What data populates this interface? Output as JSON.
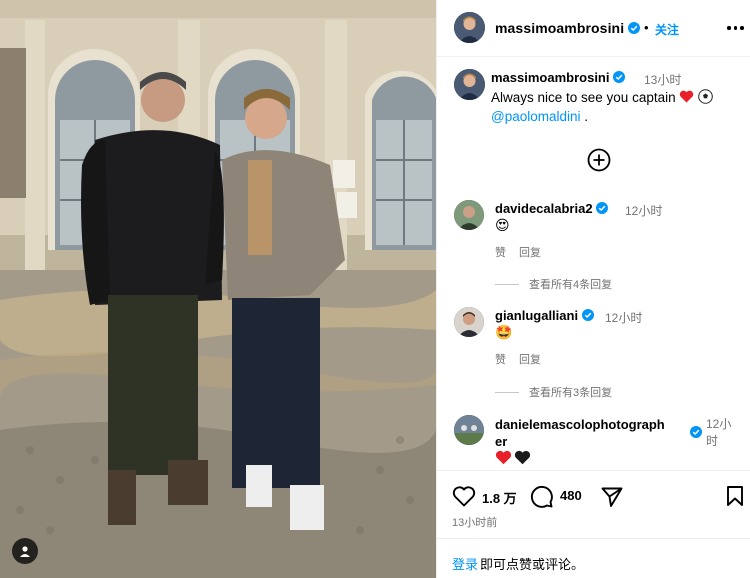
{
  "post": {
    "author": "massimoambrosini",
    "follow_label": "关注",
    "dot": "•"
  },
  "caption": {
    "user": "massimoambrosini",
    "time": "13小时",
    "text": "Always nice to see you captain",
    "mention": "@paolomaldini",
    "trailing": " ."
  },
  "comments": [
    {
      "user": "davidecalabria2",
      "time": "12小时",
      "emoji": "😍",
      "like_label": "赞",
      "reply_label": "回复",
      "view_replies": "查看所有4条回复"
    },
    {
      "user": "gianlugalliani",
      "time": "12小时",
      "emoji": "🤩",
      "like_label": "赞",
      "reply_label": "回复",
      "view_replies": "查看所有3条回复"
    },
    {
      "user_line1": "danielemascolophotograph",
      "user_line2": "er",
      "time_line1": "12小",
      "time_line2": "时"
    }
  ],
  "actions": {
    "likes": "1.8 万",
    "comments": "480"
  },
  "post_time": "13小时前",
  "footer": {
    "login_label": "登录",
    "rest": "即可点赞或评论。"
  },
  "icons": {
    "verified": "verified-badge-icon",
    "more": "more-horizontal-icon",
    "plus": "add-comment-circle-icon",
    "like": "heart-outline-icon",
    "comment": "comment-bubble-icon",
    "share": "paper-plane-icon",
    "save": "bookmark-icon"
  },
  "colors": {
    "accent": "#0095f6",
    "verified": "#0095f6",
    "secondary_text": "#737373",
    "divider": "#efefef"
  }
}
